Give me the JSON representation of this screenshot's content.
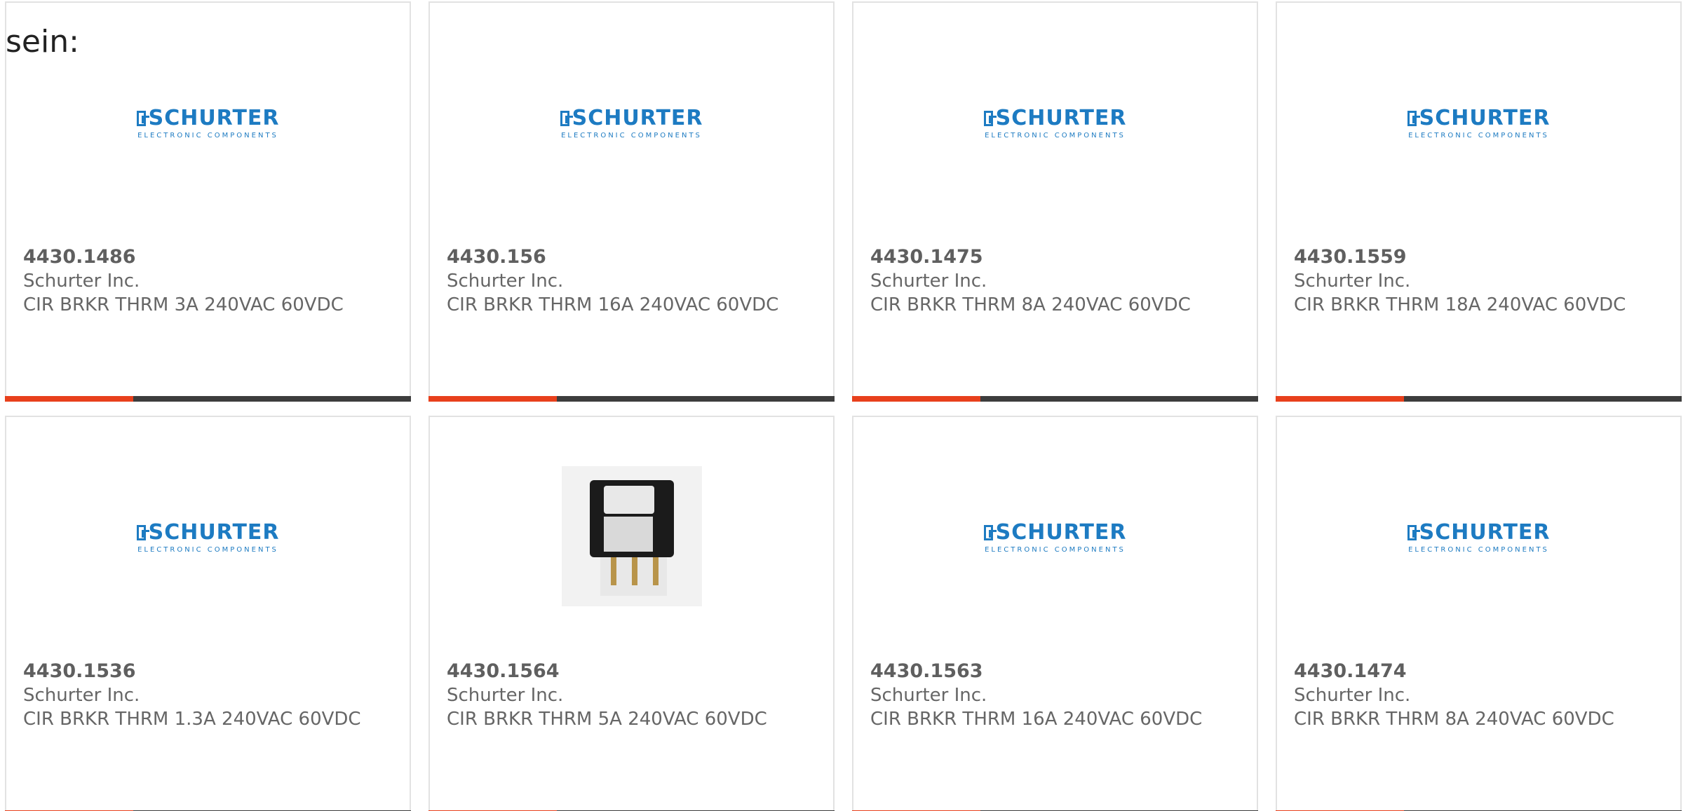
{
  "intro_text": "sein:",
  "logo": {
    "brand": "SCHURTER",
    "tagline": "ELECTRONIC COMPONENTS"
  },
  "colors": {
    "accent": "#e8401c",
    "bar": "#3d3d3d",
    "brand_blue": "#1d7bc2",
    "text": "#666666"
  },
  "products": [
    {
      "part": "4430.1486",
      "manufacturer": "Schurter Inc.",
      "description": "CIR BRKR THRM 3A 240VAC 60VDC",
      "image": "schurter-logo"
    },
    {
      "part": "4430.156",
      "manufacturer": "Schurter Inc.",
      "description": "CIR BRKR THRM 16A 240VAC 60VDC",
      "image": "schurter-logo"
    },
    {
      "part": "4430.1475",
      "manufacturer": "Schurter Inc.",
      "description": "CIR BRKR THRM 8A 240VAC 60VDC",
      "image": "schurter-logo"
    },
    {
      "part": "4430.1559",
      "manufacturer": "Schurter Inc.",
      "description": "CIR BRKR THRM 18A 240VAC 60VDC",
      "image": "schurter-logo"
    },
    {
      "part": "4430.1536",
      "manufacturer": "Schurter Inc.",
      "description": "CIR BRKR THRM 1.3A 240VAC 60VDC",
      "image": "schurter-logo"
    },
    {
      "part": "4430.1564",
      "manufacturer": "Schurter Inc.",
      "description": "CIR BRKR THRM 5A 240VAC 60VDC",
      "image": "product-photo"
    },
    {
      "part": "4430.1563",
      "manufacturer": "Schurter Inc.",
      "description": "CIR BRKR THRM 16A 240VAC 60VDC",
      "image": "schurter-logo"
    },
    {
      "part": "4430.1474",
      "manufacturer": "Schurter Inc.",
      "description": "CIR BRKR THRM 8A 240VAC 60VDC",
      "image": "schurter-logo"
    }
  ]
}
